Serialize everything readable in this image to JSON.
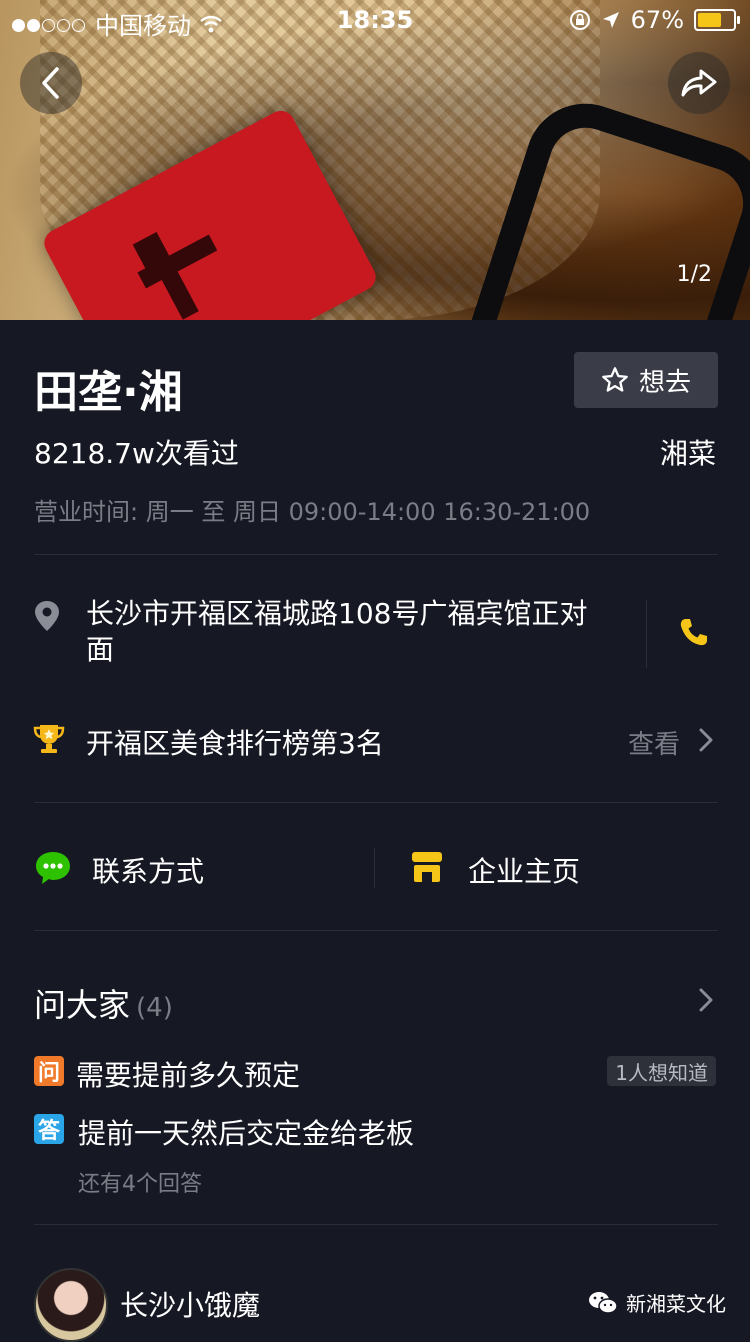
{
  "status_bar": {
    "carrier": "中国移动",
    "time": "18:35",
    "battery_percent": "67%",
    "battery_level": 0.67
  },
  "hero": {
    "image_counter": "1/2"
  },
  "restaurant": {
    "name": "田垄·湘",
    "want_label": "想去",
    "views": "8218.7w次看过",
    "cuisine": "湘菜",
    "hours": "营业时间: 周一 至 周日  09:00-14:00 16:30-21:00",
    "address": "长沙市开福区福城路108号广福宾馆正对面",
    "ranking": "开福区美食排行榜第3名",
    "ranking_action": "查看"
  },
  "actions": {
    "contact_label": "联系方式",
    "homepage_label": "企业主页"
  },
  "qa": {
    "title": "问大家",
    "count": "(4)",
    "question_badge": "问",
    "question": "需要提前多久预定",
    "question_tag": "1人想知道",
    "answer_badge": "答",
    "answer": "提前一天然后交定金给老板",
    "more_answers": "还有4个回答"
  },
  "review": {
    "username": "长沙小饿魔"
  },
  "watermark": {
    "text": "新湘菜文化"
  },
  "colors": {
    "background": "#161823",
    "accent_yellow": "#f5c518",
    "wechat_green": "#2dc100",
    "question_orange": "#f07a2a",
    "answer_blue": "#2aa5e8"
  }
}
